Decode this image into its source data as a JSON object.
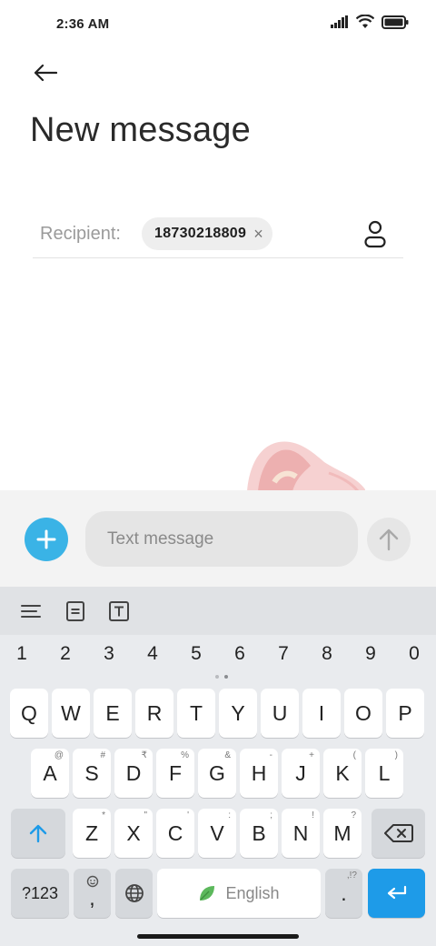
{
  "status_bar": {
    "time": "2:36 AM"
  },
  "header": {
    "title": "New message"
  },
  "recipient": {
    "label": "Recipient:",
    "chip_number": "18730218809",
    "chip_remove": "×"
  },
  "compose": {
    "placeholder": "Text message"
  },
  "keyboard": {
    "numbers": [
      "1",
      "2",
      "3",
      "4",
      "5",
      "6",
      "7",
      "8",
      "9",
      "0"
    ],
    "row1": [
      "Q",
      "W",
      "E",
      "R",
      "T",
      "Y",
      "U",
      "I",
      "O",
      "P"
    ],
    "row2": [
      {
        "key": "A",
        "hint": "@"
      },
      {
        "key": "S",
        "hint": "#"
      },
      {
        "key": "D",
        "hint": "₹"
      },
      {
        "key": "F",
        "hint": "%"
      },
      {
        "key": "G",
        "hint": "&"
      },
      {
        "key": "H",
        "hint": "-"
      },
      {
        "key": "J",
        "hint": "+"
      },
      {
        "key": "K",
        "hint": "("
      },
      {
        "key": "L",
        "hint": ")"
      }
    ],
    "row3": [
      {
        "key": "Z",
        "hint": "*"
      },
      {
        "key": "X",
        "hint": "\""
      },
      {
        "key": "C",
        "hint": "'"
      },
      {
        "key": "V",
        "hint": ":"
      },
      {
        "key": "B",
        "hint": ";"
      },
      {
        "key": "N",
        "hint": "!"
      },
      {
        "key": "M",
        "hint": "?"
      }
    ],
    "symbols_label": "?123",
    "comma": ",",
    "space_label": "English",
    "period": ".",
    "period_hint": ",!?"
  },
  "colors": {
    "accent": "#3ab3e6",
    "enter": "#1e9be8",
    "leaf": "#5cb85c"
  }
}
